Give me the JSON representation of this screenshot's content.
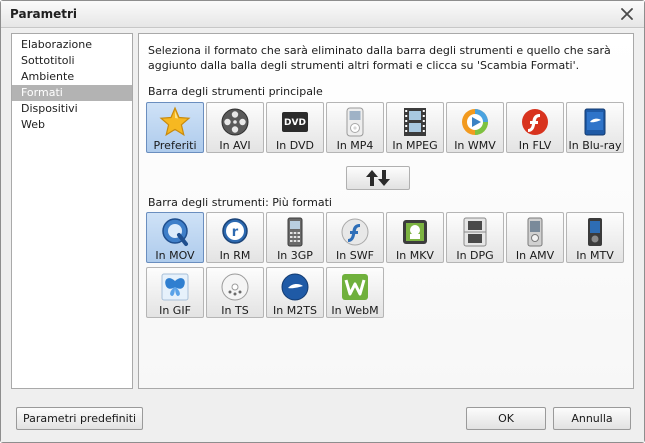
{
  "window": {
    "title": "Parametri"
  },
  "nav": {
    "items": [
      {
        "label": "Elaborazione"
      },
      {
        "label": "Sottotitoli"
      },
      {
        "label": "Ambiente"
      },
      {
        "label": "Formati",
        "selected": true
      },
      {
        "label": "Dispositivi"
      },
      {
        "label": "Web"
      }
    ]
  },
  "panel": {
    "description": "Seleziona il formato che sarà eliminato dalla barra degli strumenti e quello che sarà aggiunto dalla balla degli strumenti altri formati e clicca su 'Scambia Formati'.",
    "main_toolbar_label": "Barra degli strumenti principale",
    "more_formats_label": "Barra degli strumenti: Più formati",
    "main_formats": [
      {
        "label": "Preferiti",
        "icon": "star-icon",
        "selected": true
      },
      {
        "label": "In AVI",
        "icon": "film-reel-icon"
      },
      {
        "label": "In DVD",
        "icon": "dvd-icon"
      },
      {
        "label": "In MP4",
        "icon": "ipod-icon"
      },
      {
        "label": "In MPEG",
        "icon": "film-strip-icon"
      },
      {
        "label": "In WMV",
        "icon": "wmv-play-icon"
      },
      {
        "label": "In FLV",
        "icon": "flash-icon"
      },
      {
        "label": "In Blu-ray",
        "icon": "bluray-icon"
      }
    ],
    "more_formats": [
      {
        "label": "In MOV",
        "icon": "quicktime-icon",
        "selected": true
      },
      {
        "label": "In RM",
        "icon": "realmedia-icon"
      },
      {
        "label": "In 3GP",
        "icon": "mobile-phone-icon"
      },
      {
        "label": "In SWF",
        "icon": "swf-icon"
      },
      {
        "label": "In MKV",
        "icon": "mkv-icon"
      },
      {
        "label": "In DPG",
        "icon": "nintendo-ds-icon"
      },
      {
        "label": "In AMV",
        "icon": "amv-player-icon"
      },
      {
        "label": "In MTV",
        "icon": "mtv-player-icon"
      },
      {
        "label": "In GIF",
        "icon": "butterfly-icon"
      },
      {
        "label": "In TS",
        "icon": "ts-disc-icon"
      },
      {
        "label": "In M2TS",
        "icon": "m2ts-bluray-icon"
      },
      {
        "label": "In WebM",
        "icon": "webm-icon"
      }
    ]
  },
  "footer": {
    "defaults_label": "Parametri predefiniti",
    "ok_label": "OK",
    "cancel_label": "Annulla"
  },
  "colors": {
    "selected_nav": "#b3b3b3",
    "selected_button": "#aecbec",
    "border": "#a9a9a9"
  }
}
